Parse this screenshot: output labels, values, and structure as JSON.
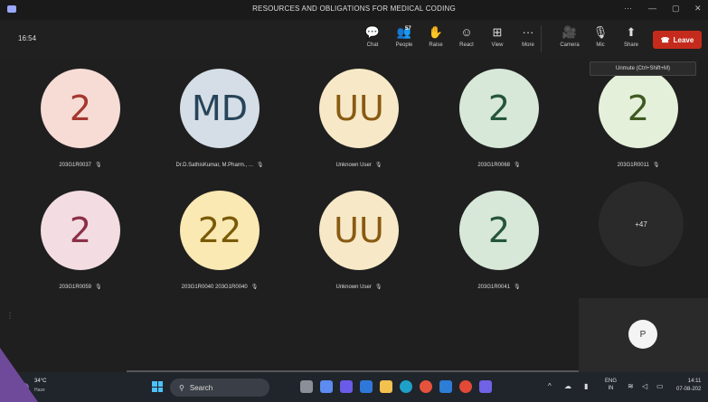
{
  "window": {
    "title": "RESOURCES AND OBLIGATIONS FOR MEDICAL CODING",
    "controls": [
      "···",
      "—",
      "▢",
      "✕"
    ]
  },
  "meeting": {
    "clock": "16:54",
    "toolbar": [
      {
        "name": "chat",
        "label": "Chat",
        "icon": "💬"
      },
      {
        "name": "people",
        "label": "People",
        "icon": "👥",
        "count": "57"
      },
      {
        "name": "raise",
        "label": "Raise",
        "icon": "✋"
      },
      {
        "name": "react",
        "label": "React",
        "icon": "☺"
      },
      {
        "name": "view",
        "label": "View",
        "icon": "⊞"
      },
      {
        "name": "more",
        "label": "More",
        "icon": "···"
      },
      {
        "name": "camera",
        "label": "Camera",
        "icon": "🎥"
      },
      {
        "name": "mic",
        "label": "Mic",
        "icon": "🎙"
      },
      {
        "name": "share",
        "label": "Share",
        "icon": "⬆"
      }
    ],
    "leave_label": "Leave",
    "leave_icon": "☎",
    "tooltip": "Unmute (Ctrl+Shift+M)",
    "mute_icon": "🎙",
    "participants": [
      {
        "initials": "2",
        "name": "203G1R0037",
        "bg": "#f7dcd6",
        "fg": "#a4382f"
      },
      {
        "initials": "MD",
        "name": "Dr.D.SathisKumar, M.Pharm., ...",
        "bg": "#d5dee6",
        "fg": "#274459"
      },
      {
        "initials": "UU",
        "name": "Unknown User",
        "bg": "#f7e9c7",
        "fg": "#8a5a12"
      },
      {
        "initials": "2",
        "name": "203G1R0068",
        "bg": "#d7e8d9",
        "fg": "#25553a"
      },
      {
        "initials": "2",
        "name": "203G1R0011",
        "bg": "#e5f0da",
        "fg": "#3f5a22"
      },
      {
        "initials": "2",
        "name": "203G1R0059",
        "bg": "#f3dde2",
        "fg": "#8c2f48"
      },
      {
        "initials": "22",
        "name": "203G1R0040 203G1R0040",
        "bg": "#fbe9b3",
        "fg": "#7a5a08"
      },
      {
        "initials": "UU",
        "name": "Unknown User",
        "bg": "#f7e9c7",
        "fg": "#8a5a12"
      },
      {
        "initials": "2",
        "name": "203G1R0041",
        "bg": "#d7e8d9",
        "fg": "#25553a"
      }
    ],
    "more_count": "+47",
    "self_initial": "P"
  },
  "taskbar": {
    "weather": {
      "temp": "34°C",
      "condition": "Haze"
    },
    "search_label": "Search",
    "lang": [
      "ENG",
      "IN"
    ],
    "time": "14:11",
    "date": "07-08-202"
  }
}
